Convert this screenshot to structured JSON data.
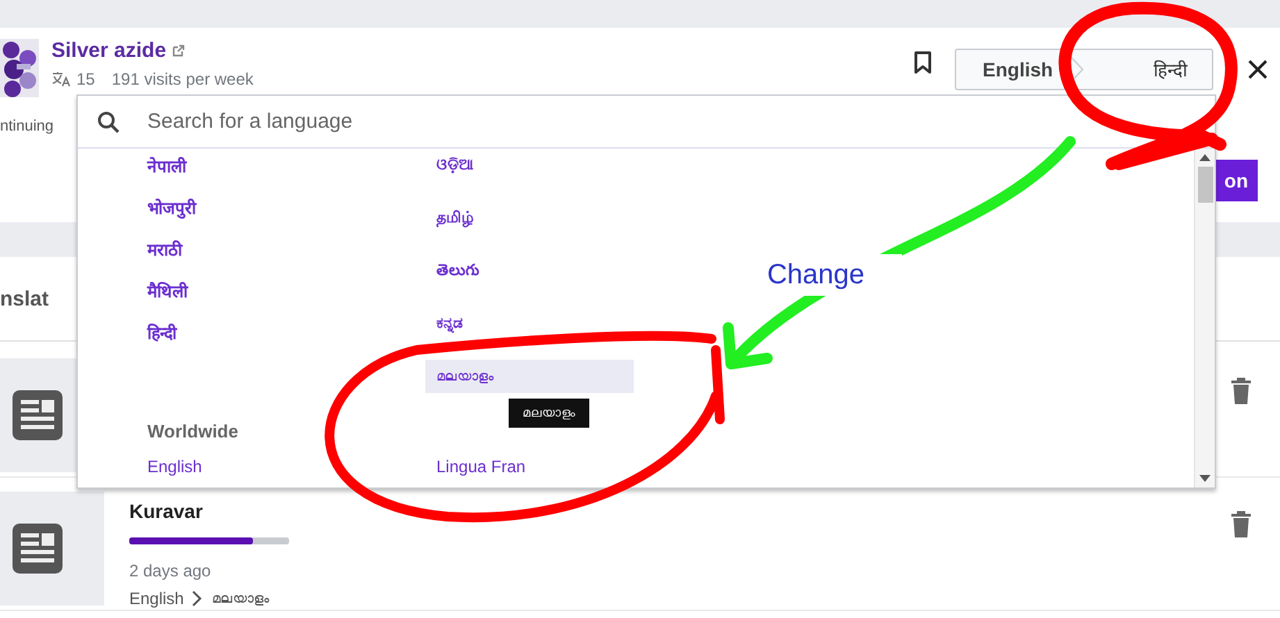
{
  "article": {
    "title": "Silver azide",
    "language_count": "15",
    "visits": "191 visits per week"
  },
  "language_selector": {
    "source": "English",
    "target": "हिन्दी"
  },
  "background": {
    "continuing_text": "ntinuing",
    "button_label": "on",
    "section_title": "nslat"
  },
  "language_menu": {
    "search_placeholder": "Search for a language",
    "columns": [
      [
        {
          "label": "नेपाली",
          "highlighted": false
        },
        {
          "label": "भोजपुरी",
          "highlighted": false
        },
        {
          "label": "मराठी",
          "highlighted": false
        },
        {
          "label": "मैथिली",
          "highlighted": false
        },
        {
          "label": "हिन्दी",
          "highlighted": false
        }
      ],
      [
        {
          "label": "ଓଡ଼ିଆ",
          "highlighted": false
        },
        {
          "label": "தமிழ்",
          "highlighted": false
        },
        {
          "label": "తెలుగు",
          "highlighted": false
        },
        {
          "label": "ಕನ್ನಡ",
          "highlighted": false
        },
        {
          "label": "മലയാളം",
          "highlighted": true
        }
      ]
    ],
    "tooltip": "മലയാളം",
    "worldwide_heading": "Worldwide",
    "worldwide": [
      {
        "label": "English"
      },
      {
        "label": "Lingua Fran"
      }
    ]
  },
  "translations": [
    {
      "kind": "covered"
    },
    {
      "kind": "full",
      "title": "Kuravar",
      "level": 0.77,
      "time": "2 days ago",
      "source": "English",
      "target": "മലയാളം"
    }
  ],
  "annotation": {
    "label": "Change"
  }
}
